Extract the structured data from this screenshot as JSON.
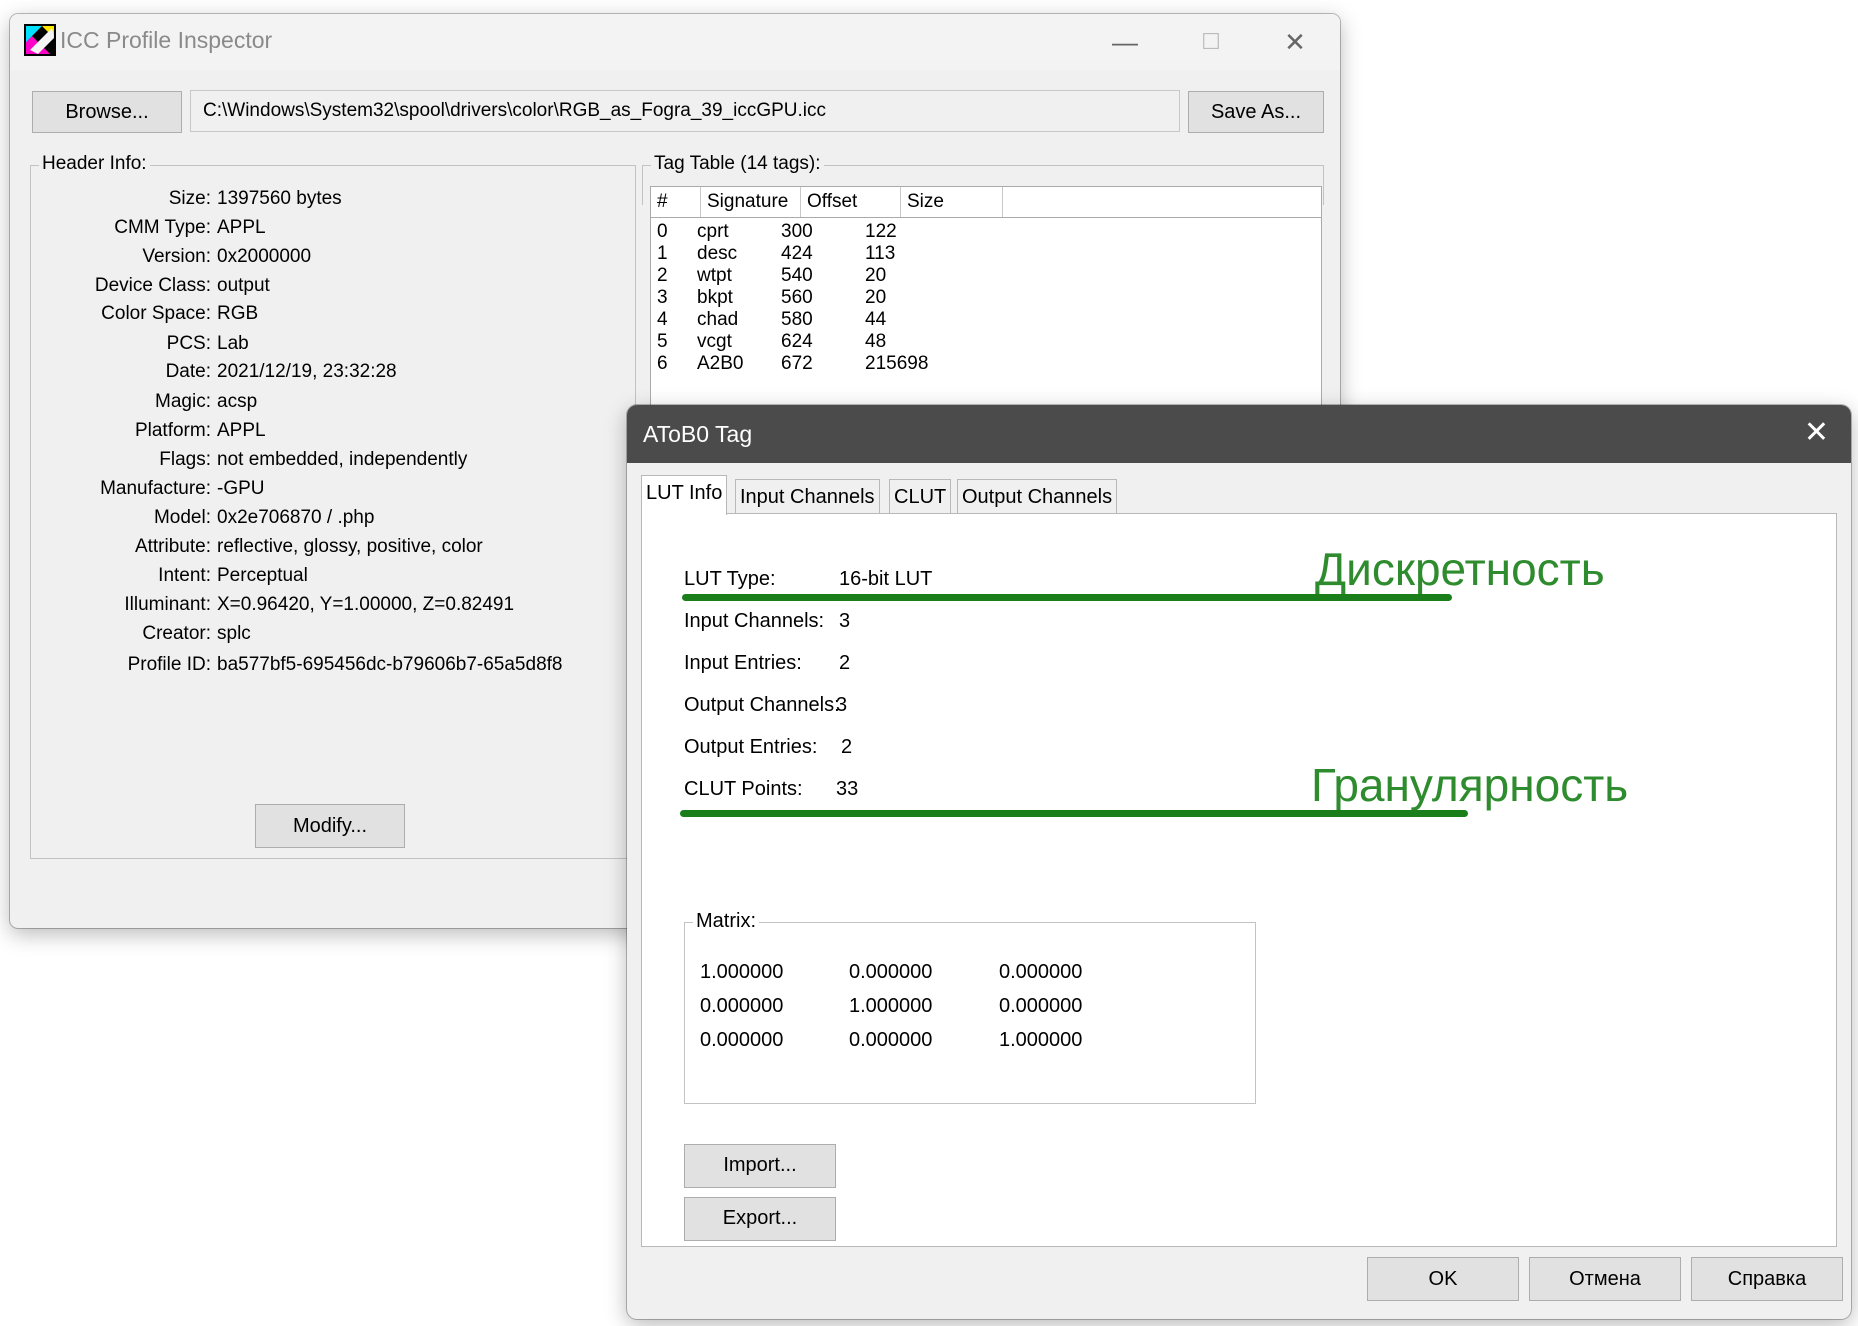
{
  "main_window": {
    "title": "ICC Profile Inspector",
    "minimize_glyph": "—",
    "maximize_glyph": "☐",
    "close_glyph": "✕",
    "browse_label": "Browse...",
    "file_path": "C:\\Windows\\System32\\spool\\drivers\\color\\RGB_as_Fogra_39_iccGPU.icc",
    "save_as_label": "Save As...",
    "header_info": {
      "legend": "Header Info:",
      "fields": [
        {
          "label": "Size:",
          "value": "1397560 bytes"
        },
        {
          "label": "CMM Type:",
          "value": "APPL"
        },
        {
          "label": "Version:",
          "value": "0x2000000"
        },
        {
          "label": "Device Class:",
          "value": "output"
        },
        {
          "label": "Color Space:",
          "value": "RGB"
        },
        {
          "label": "PCS:",
          "value": "Lab"
        },
        {
          "label": "Date:",
          "value": "2021/12/19, 23:32:28"
        },
        {
          "label": "Magic:",
          "value": "acsp"
        },
        {
          "label": "Platform:",
          "value": "APPL"
        },
        {
          "label": "Flags:",
          "value": "not embedded, independently"
        },
        {
          "label": "Manufacture:",
          "value": "-GPU"
        },
        {
          "label": "Model:",
          "value": "0x2e706870 / .php"
        },
        {
          "label": "Attribute:",
          "value": "reflective, glossy, positive, color"
        },
        {
          "label": "Intent:",
          "value": "Perceptual"
        },
        {
          "label": "Illuminant:",
          "value": "X=0.96420, Y=1.00000, Z=0.82491"
        },
        {
          "label": "Creator:",
          "value": "splc"
        },
        {
          "label": "Profile ID:",
          "value": "ba577bf5-695456dc-b79606b7-65a5d8f8"
        }
      ],
      "modify_label": "Modify..."
    },
    "tag_table": {
      "legend": "Tag Table (14 tags):",
      "columns": [
        "#",
        "Signature",
        "Offset",
        "Size"
      ],
      "rows": [
        [
          "0",
          "cprt",
          "300",
          "122"
        ],
        [
          "1",
          "desc",
          "424",
          "113"
        ],
        [
          "2",
          "wtpt",
          "540",
          "20"
        ],
        [
          "3",
          "bkpt",
          "560",
          "20"
        ],
        [
          "4",
          "chad",
          "580",
          "44"
        ],
        [
          "5",
          "vcgt",
          "624",
          "48"
        ],
        [
          "6",
          "A2B0",
          "672",
          "215698"
        ]
      ]
    }
  },
  "dialog": {
    "title": "AToB0 Tag",
    "close_glyph": "✕",
    "tabs": [
      "LUT Info",
      "Input Channels",
      "CLUT",
      "Output Channels"
    ],
    "active_tab": "LUT Info",
    "lut_info": [
      {
        "label": "LUT Type:",
        "value": "16-bit LUT"
      },
      {
        "label": "Input Channels:",
        "value": "3"
      },
      {
        "label": "Input Entries:",
        "value": "2"
      },
      {
        "label": "Output Channels:",
        "value": "3"
      },
      {
        "label": "Output Entries:",
        "value": "2"
      },
      {
        "label": "CLUT Points:",
        "value": "33"
      }
    ],
    "annotations": {
      "lut_type": "Дискретность",
      "clut_points": "Гранулярность",
      "color": "#1a7f1a"
    },
    "matrix": {
      "legend": "Matrix:",
      "rows": [
        [
          "1.000000",
          "0.000000",
          "0.000000"
        ],
        [
          "0.000000",
          "1.000000",
          "0.000000"
        ],
        [
          "0.000000",
          "0.000000",
          "1.000000"
        ]
      ]
    },
    "import_label": "Import...",
    "export_label": "Export...",
    "ok_label": "OK",
    "cancel_label": "Отмена",
    "help_label": "Справка"
  }
}
